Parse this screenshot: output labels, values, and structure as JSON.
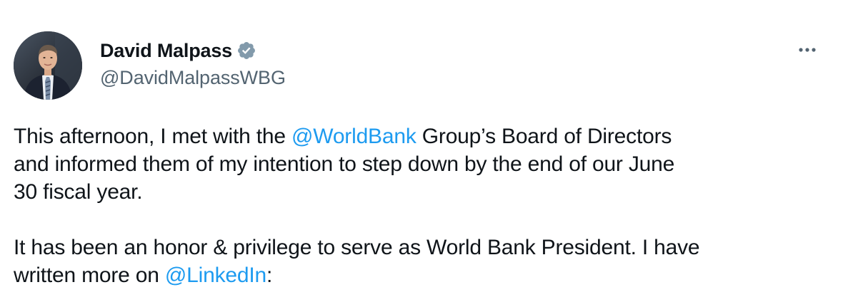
{
  "author": {
    "display_name": "David Malpass",
    "handle": "@DavidMalpassWBG",
    "verified": true,
    "avatar_icon": "profile-photo"
  },
  "colors": {
    "text": "#0f1419",
    "secondary": "#536471",
    "link": "#1d9bf0",
    "verified_badge": "#829aab"
  },
  "menu": {
    "icon": "more-horizontal-icon"
  },
  "tweet": {
    "p1": {
      "t1": "This afternoon, I met with the ",
      "m1": "@WorldBank",
      "t2": " Group’s Board of Directors",
      "t3": "and informed them of my intention to step down by the end of our June",
      "t4": "30 fiscal year."
    },
    "p2": {
      "t1": "It has been an honor & privilege to serve as World Bank President. I have",
      "t2": "written more on ",
      "m1": "@LinkedIn",
      "t3": ":"
    }
  }
}
